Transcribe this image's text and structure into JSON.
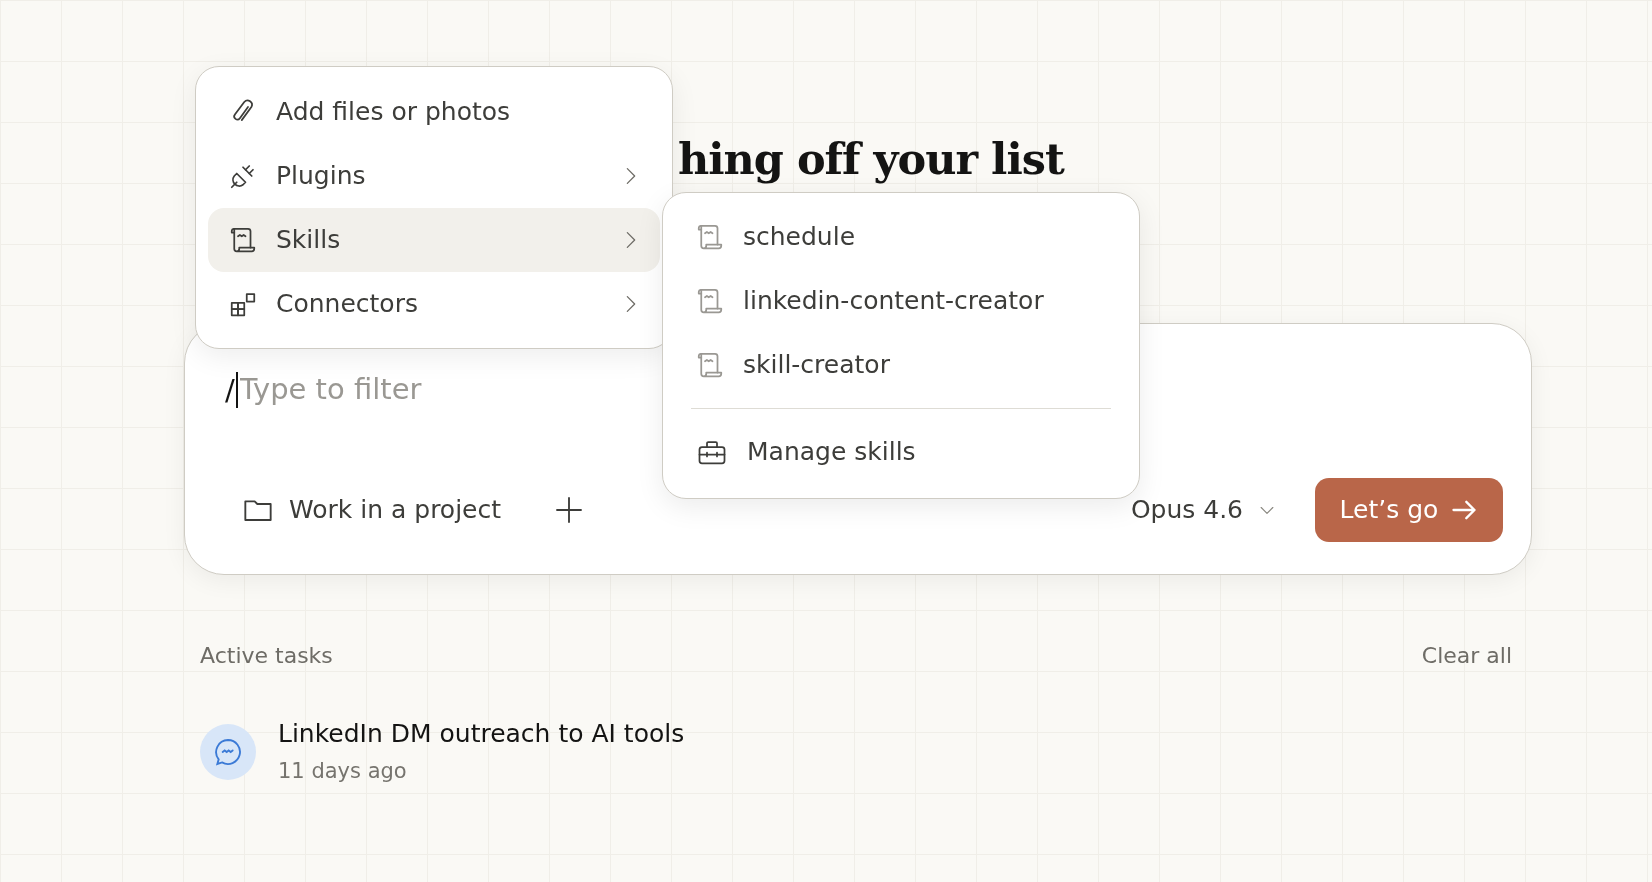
{
  "heading": "hing off your list",
  "attach_menu": {
    "items": [
      {
        "label": "Add files or photos",
        "has_submenu": false,
        "selected": false
      },
      {
        "label": "Plugins",
        "has_submenu": true,
        "selected": false
      },
      {
        "label": "Skills",
        "has_submenu": true,
        "selected": true
      },
      {
        "label": "Connectors",
        "has_submenu": true,
        "selected": false
      }
    ]
  },
  "skills_menu": {
    "items": [
      {
        "label": "schedule"
      },
      {
        "label": "linkedin-content-creator"
      },
      {
        "label": "skill-creator"
      }
    ],
    "footer_action": "Manage skills"
  },
  "composer": {
    "typed": "/",
    "placeholder": "Type to filter",
    "project_button": "Work in a project",
    "model": "Opus 4.6",
    "submit": "Let’s go"
  },
  "tasks": {
    "title": "Active tasks",
    "clear": "Clear all",
    "items": [
      {
        "title": "LinkedIn DM outreach to AI tools",
        "time": "11 days ago"
      }
    ]
  }
}
